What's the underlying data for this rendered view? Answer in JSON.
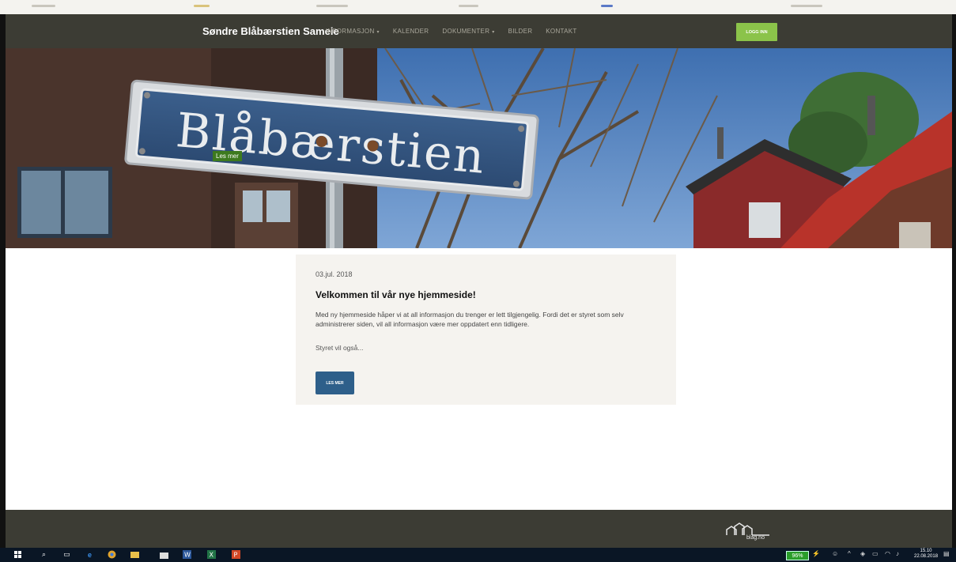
{
  "site": {
    "title": "Søndre Blåbærstien Sameie",
    "nav": [
      {
        "label": "INFORMASJON",
        "dropdown": true
      },
      {
        "label": "KALENDER",
        "dropdown": false
      },
      {
        "label": "DOKUMENTER",
        "dropdown": true
      },
      {
        "label": "BILDER",
        "dropdown": false
      },
      {
        "label": "KONTAKT",
        "dropdown": false
      }
    ],
    "login_label": "LOGG INN"
  },
  "hero": {
    "sign_text": "Blåbærstien",
    "tag": "Les mer"
  },
  "post": {
    "date": "03.jul. 2018",
    "title": "Velkommen til vår nye hjemmeside!",
    "body": "Med ny hjemmeside håper vi at all informasjon du trenger er lett tilgjengelig. Fordi det er styret som selv administrerer siden, vil all informasjon være mer oppdatert enn tidligere.",
    "excerpt": "Styret vil også...",
    "button_label": "LES MER"
  },
  "footer": {
    "logo_text": "blag.no"
  },
  "taskbar": {
    "battery": "96%",
    "time": "15.10",
    "date": "22.08.2018"
  },
  "colors": {
    "nav_bg": "#3c3c34",
    "login_bg": "#8bc34a",
    "tag_bg": "#3d7a1e",
    "button_bg": "#2e5f8a",
    "card_bg": "#f5f3ef"
  }
}
